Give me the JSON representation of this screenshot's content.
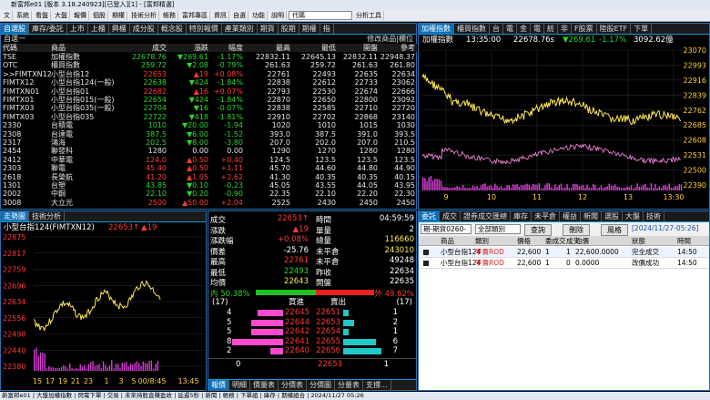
{
  "title_bar": "新富邦e01 [版本 3.18.240923][已登入][1] - [富邦精選]",
  "menu": [
    "文",
    "系統",
    "看盤",
    "大盤",
    "報價",
    "個股",
    "期權",
    "技術分析",
    "帳務",
    "富邦專區",
    "資訊",
    "自選",
    "功能",
    "說明"
  ],
  "menu_select": "代碼",
  "menu_tool": "分析工具",
  "watch": {
    "tabs": [
      "自選股",
      "庫存/委託",
      "上市",
      "上櫃",
      "興櫃",
      "成分股",
      "概念股",
      "特別報價",
      "產業類別",
      "期貨",
      "股期",
      "期權",
      "指"
    ],
    "group": "自選一",
    "edit_label": "修改商品|欄位",
    "headers": [
      "代碼",
      "商品",
      "成交",
      "漲跌",
      "幅度",
      "最高",
      "最低",
      "開盤",
      "參考"
    ],
    "rows": [
      {
        "code": "TSE",
        "name": "加權指數",
        "price": "22678.76",
        "chg": "▼269.61",
        "pct": "-1.17%",
        "high": "22832.11",
        "low": "22645.13",
        "open": "22832.11",
        "ref": "22948.37",
        "d": "dn"
      },
      {
        "code": "OTC",
        "name": "櫃買指數",
        "price": "259.72",
        "chg": "▼2.08",
        "pct": "-0.79%",
        "high": "261.63",
        "low": "259.72",
        "open": "261.63",
        "ref": "261.80",
        "d": "dn"
      },
      {
        "code": ">>FIMTXN12",
        "name": "小型台指12",
        "price": "22653",
        "chg": "▲19",
        "pct": "+0.08%",
        "high": "22761",
        "low": "22493",
        "open": "22635",
        "ref": "22634",
        "d": "up"
      },
      {
        "code": "FIMTX12",
        "name": "小型台指124(一般)",
        "price": "22638",
        "chg": "▼424",
        "pct": "-1.84%",
        "high": "22838",
        "low": "22612",
        "open": "22733",
        "ref": "23062",
        "d": "dn"
      },
      {
        "code": "FIMTXN01",
        "name": "小型台指01",
        "price": "22682",
        "chg": "▲16",
        "pct": "+0.07%",
        "high": "22793",
        "low": "22530",
        "open": "22674",
        "ref": "22666",
        "d": "up"
      },
      {
        "code": "FIMTX01",
        "name": "小型台指015(一般)",
        "price": "22654",
        "chg": "▼424",
        "pct": "-1.84%",
        "high": "22870",
        "low": "22650",
        "open": "22800",
        "ref": "23092",
        "d": "dn"
      },
      {
        "code": "FIMTX03",
        "name": "小型台指035(一般)",
        "price": "22704",
        "chg": "▼16",
        "pct": "-0.07%",
        "high": "22838",
        "low": "22585",
        "open": "22710",
        "ref": "22720",
        "d": "dn"
      },
      {
        "code": "FIMTX03",
        "name": "小型台指035",
        "price": "22722",
        "chg": "▼418",
        "pct": "-1.81%",
        "high": "22910",
        "low": "22702",
        "open": "22868",
        "ref": "23140",
        "d": "dn"
      },
      {
        "code": "2330",
        "name": "台積電",
        "price": "1010",
        "chg": "▼20.00",
        "pct": "-1.94",
        "high": "1020",
        "low": "1010",
        "open": "1015",
        "ref": "1030",
        "d": "dn"
      },
      {
        "code": "2308",
        "name": "台達電",
        "price": "387.5",
        "chg": "▼6.00",
        "pct": "-1.52",
        "high": "393.0",
        "low": "387.5",
        "open": "391.0",
        "ref": "393.5",
        "d": "dn"
      },
      {
        "code": "2317",
        "name": "鴻海",
        "price": "202.5",
        "chg": "▼8.00",
        "pct": "-3.80",
        "high": "207.0",
        "low": "202.0",
        "open": "207.0",
        "ref": "210.5",
        "d": "dn"
      },
      {
        "code": "2454",
        "name": "聯發科",
        "price": "1280",
        "chg": "0.00",
        "pct": "0.00",
        "high": "1290",
        "low": "1270",
        "open": "1280",
        "ref": "1280",
        "d": "eq"
      },
      {
        "code": "2412",
        "name": "中華電",
        "price": "124.0",
        "chg": "▲0.50",
        "pct": "+0.40",
        "high": "124.5",
        "low": "123.5",
        "open": "123.5",
        "ref": "123.5",
        "d": "up"
      },
      {
        "code": "2303",
        "name": "聯電",
        "price": "45.40",
        "chg": "▲0.50",
        "pct": "+1.11",
        "high": "45.70",
        "low": "44.60",
        "open": "44.80",
        "ref": "44.90",
        "d": "up"
      },
      {
        "code": "2618",
        "name": "長榮航",
        "price": "41.20",
        "chg": "▲1.05",
        "pct": "+2.62",
        "high": "41.30",
        "low": "40.35",
        "open": "40.35",
        "ref": "40.15",
        "d": "up"
      },
      {
        "code": "1301",
        "name": "台塑",
        "price": "43.85",
        "chg": "▼0.10",
        "pct": "-0.23",
        "high": "45.05",
        "low": "43.55",
        "open": "44.05",
        "ref": "43.95",
        "d": "dn"
      },
      {
        "code": "2002",
        "name": "中鋼",
        "price": "22.10",
        "chg": "▼0.20",
        "pct": "-0.90",
        "high": "22.35",
        "low": "22.10",
        "open": "22.20",
        "ref": "22.30",
        "d": "dn"
      },
      {
        "code": "3008",
        "name": "大立光",
        "price": "2500",
        "chg": "▲50.00",
        "pct": "+2.04",
        "high": "2525",
        "low": "2430",
        "open": "2450",
        "ref": "2450",
        "d": "up"
      }
    ]
  },
  "index_chart": {
    "tabs": [
      "加權指數",
      "櫃買指數",
      "台",
      "電",
      "金",
      "電",
      "紡",
      "非",
      "F股票",
      "陸股ETF",
      "下單"
    ],
    "time": "13:35:00",
    "price": "22678.76s",
    "chg": "▼269.61",
    "pct": "-1.17%",
    "volume": "3092.62億",
    "yticks": [
      "23070",
      "22993",
      "22916",
      "22839",
      "22762",
      "22685",
      "22608",
      "22531",
      "22500",
      "22390"
    ],
    "xticks": [
      "9",
      "10",
      "11",
      "12",
      "13",
      "13:30"
    ]
  },
  "trend": {
    "tabs": [
      "走勢圖",
      "技術分析"
    ],
    "symbol": "小型台指124(FIMTXN12)",
    "price": "22653↑",
    "chg": "▲19",
    "yticks": [
      "22875",
      "22817",
      "22759",
      "22696",
      "22634",
      "22556",
      "22498",
      "22440",
      "22380"
    ],
    "xticks": [
      "15",
      "17",
      "19",
      "21",
      "23",
      "1",
      "3",
      "5",
      "00/8:45",
      "13:45"
    ]
  },
  "quote": {
    "left": [
      [
        "成交",
        "22653↑"
      ],
      [
        "漲跌",
        "▲19"
      ],
      [
        "漲跌幅",
        "+0.08%"
      ],
      [
        "價差",
        "-25.76"
      ],
      [
        "最高",
        "22761"
      ],
      [
        "最低",
        "22493"
      ],
      [
        "均價",
        "22643"
      ]
    ],
    "right": [
      [
        "時間",
        "04:59:59"
      ],
      [
        "單量",
        "2"
      ],
      [
        "總量",
        "116660"
      ],
      [
        "未平倉",
        "243010"
      ],
      [
        "未平倉",
        "49248"
      ],
      [
        "昨收",
        "22634"
      ],
      [
        "開盤",
        "22635"
      ]
    ],
    "in_pct": "內 50.38%",
    "out_pct": "外 49.62%",
    "bid_label": "買進",
    "ask_label": "賣出",
    "bid_total": "(17)",
    "ask_total": "(17)",
    "book": [
      {
        "bq": "4",
        "bp": "22645",
        "ap": "22651",
        "aq": "1"
      },
      {
        "bq": "5",
        "bp": "22644",
        "ap": "22653",
        "aq": "2"
      },
      {
        "bq": "5",
        "bp": "22642",
        "ap": "22654",
        "aq": "1"
      },
      {
        "bq": "8",
        "bp": "22641",
        "ap": "22655",
        "aq": "6"
      },
      {
        "bq": "2",
        "bp": "22640",
        "ap": "22656",
        "aq": "7"
      }
    ],
    "bottom": [
      "0",
      "22653",
      "1"
    ],
    "bottom_tabs": [
      "報價",
      "明細",
      "價量表",
      "分價表",
      "分價圖",
      "分量表",
      "支撐..."
    ]
  },
  "orders": {
    "tabs": [
      "委託",
      "成交",
      "證券成交匯總",
      "庫存",
      "未平倉",
      "權益",
      "新聞",
      "選股",
      "大盤",
      "技術"
    ],
    "account": "期-期貨0260-",
    "filter": "全部類別",
    "btn_query": "查詢",
    "btn_cancel": "刪除",
    "btn_risk": "風格",
    "date": "[2024/11/27-05:26]",
    "headers": [
      "商品",
      "類別",
      "價格",
      "委成交",
      "成交",
      "均價",
      "狀態",
      "時間"
    ],
    "rows": [
      [
        "小型台指124",
        "平賣ROD",
        "22,600",
        "1",
        "1",
        "22,600.0000",
        "完全成交",
        "14:50"
      ],
      [
        "小型台指124",
        "平賣ROD",
        "22,600",
        "1",
        "0",
        "0.0000",
        "改價成功",
        "14:50"
      ]
    ]
  },
  "status": "新富邦e01 | 大盤加權指數 | 閃電下單 | 交易 | 未來持股直賺盈收 | 延遲5秒 | 新聞 | 帳務 | 下單組 | 庫存 | 期權組合 | 2024/11/27 05:26"
}
